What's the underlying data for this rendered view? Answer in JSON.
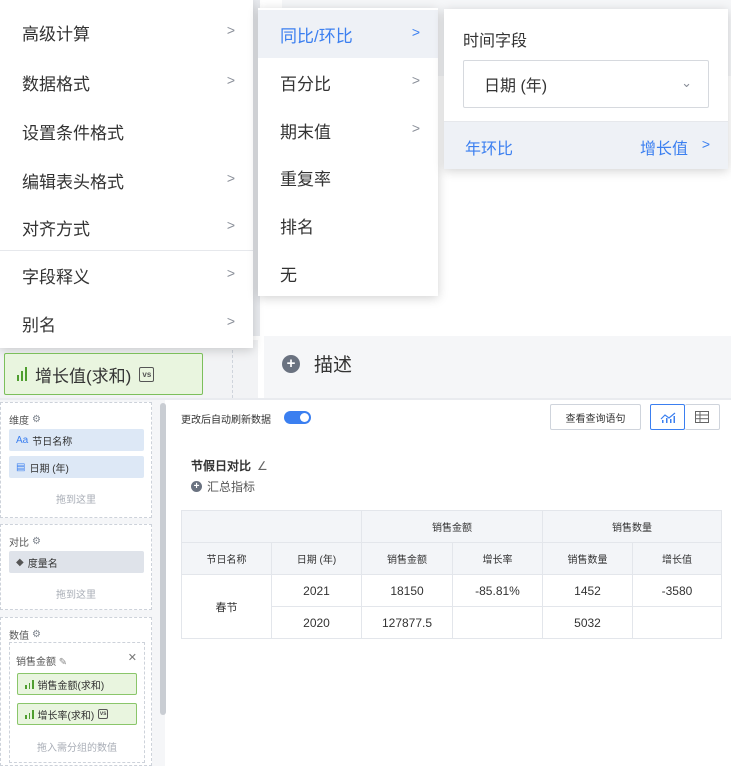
{
  "menu_level1": {
    "items": [
      {
        "label": "高级计算",
        "has_submenu": true
      },
      {
        "label": "数据格式",
        "has_submenu": true
      },
      {
        "label": "设置条件格式",
        "has_submenu": false
      },
      {
        "label": "编辑表头格式",
        "has_submenu": true
      },
      {
        "label": "对齐方式",
        "has_submenu": true
      },
      {
        "label": "字段释义",
        "has_submenu": true
      },
      {
        "label": "别名",
        "has_submenu": true
      }
    ]
  },
  "menu_level2": {
    "items": [
      {
        "label": "同比/环比",
        "has_submenu": true,
        "active": true
      },
      {
        "label": "百分比",
        "has_submenu": true
      },
      {
        "label": "期末值",
        "has_submenu": true
      },
      {
        "label": "重复率",
        "has_submenu": false
      },
      {
        "label": "排名",
        "has_submenu": false
      },
      {
        "label": "无",
        "has_submenu": false
      }
    ]
  },
  "menu_level3": {
    "time_field_label": "时间字段",
    "time_field_value": "日期 (年)",
    "yoy_label": "年环比",
    "yoy_value": "增长值"
  },
  "zoom": {
    "measure_chip": "增长值(求和)",
    "description_label": "描述"
  },
  "fields_panel": {
    "dimension_title": "维度",
    "dimension_fields": [
      {
        "prefix": "Aa",
        "label": "节日名称"
      },
      {
        "prefix": "▤",
        "label": "日期 (年)"
      }
    ],
    "dimension_drop_hint": "拖到这里",
    "compare_title": "对比",
    "compare_field": "度量名",
    "compare_drop_hint": "拖到这里",
    "value_title": "数值",
    "group_label": "销售金额",
    "value_fields": [
      "销售金额(求和)",
      "增长率(求和)"
    ],
    "value_drop_hint": "拖入需分组的数值"
  },
  "toolbar": {
    "auto_refresh_label": "更改后自动刷新数据",
    "auto_refresh_on": true,
    "query_button": "查看查询语句"
  },
  "card": {
    "title": "节假日对比",
    "add_metric_label": "汇总指标"
  },
  "table": {
    "group_headers": [
      "销售金额",
      "销售数量"
    ],
    "columns": [
      "节日名称",
      "日期 (年)",
      "销售金额",
      "增长率",
      "销售数量",
      "增长值"
    ],
    "group_row_label": "春节",
    "rows": [
      {
        "year": "2021",
        "sales_amount": "18150",
        "growth_rate": "-85.81%",
        "sales_qty": "1452",
        "growth_value": "-3580"
      },
      {
        "year": "2020",
        "sales_amount": "127877.5",
        "growth_rate": "",
        "sales_qty": "5032",
        "growth_value": ""
      }
    ]
  },
  "colors": {
    "accent": "#3b7ff0",
    "measure_green": "#4f9e2f",
    "measure_bg": "#e9f5df",
    "dimension_bg": "#dde8f6"
  }
}
